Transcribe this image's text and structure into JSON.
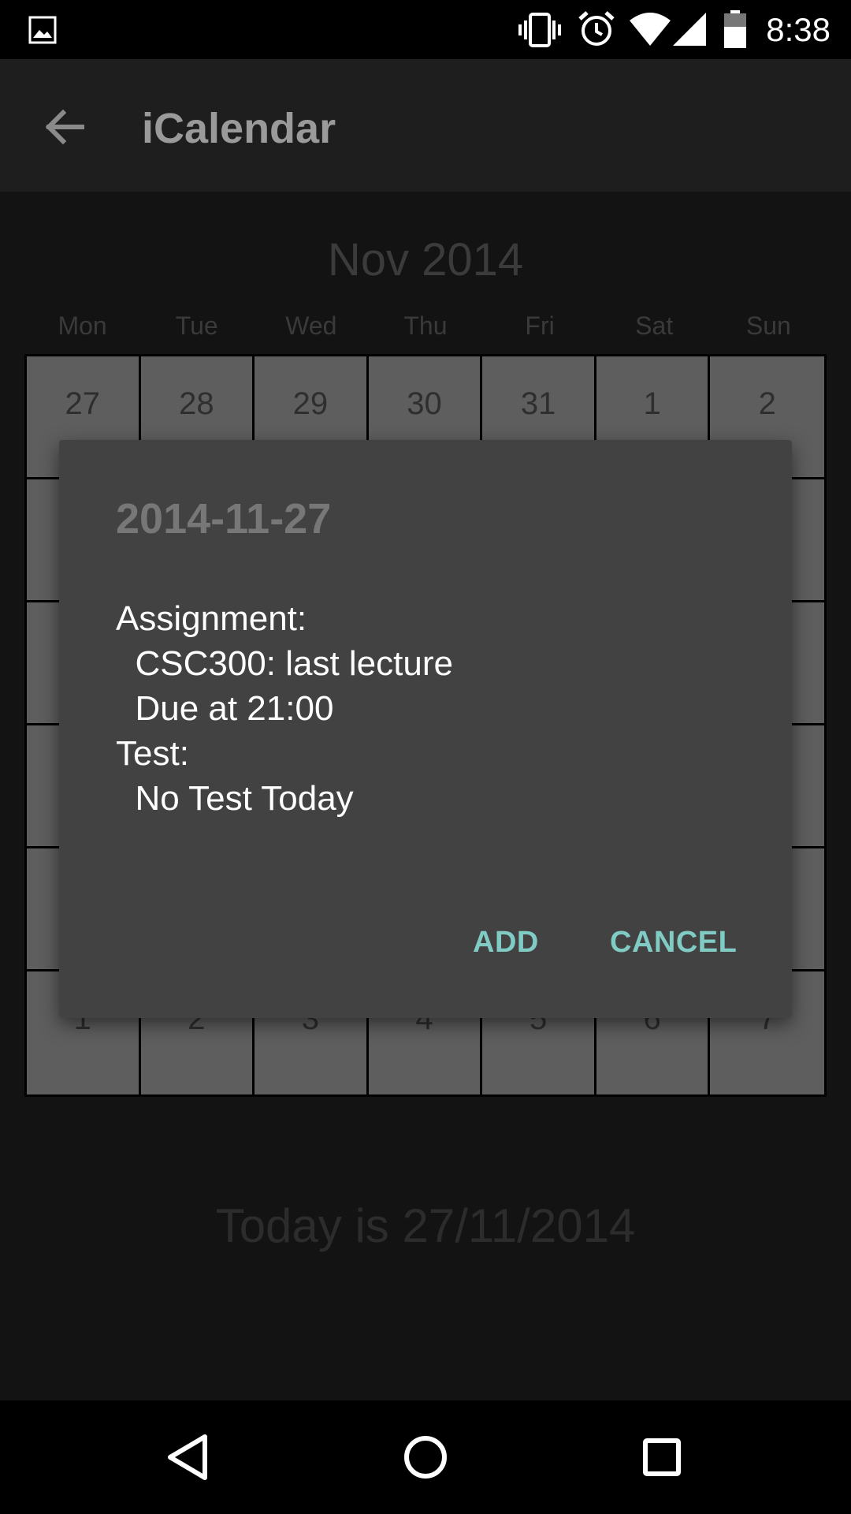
{
  "status_bar": {
    "time": "8:38",
    "icons": [
      "image-icon",
      "vibrate-icon",
      "alarm-icon",
      "wifi-icon",
      "signal-icon",
      "battery-icon"
    ]
  },
  "app_bar": {
    "back_icon": "arrow-left-icon",
    "title": "iCalendar"
  },
  "calendar": {
    "month": "Nov 2014",
    "weekdays": [
      "Mon",
      "Tue",
      "Wed",
      "Thu",
      "Fri",
      "Sat",
      "Sun"
    ],
    "weeks": [
      [
        "27",
        "28",
        "29",
        "30",
        "31",
        "1",
        "2"
      ],
      [
        "",
        "",
        "",
        "",
        "",
        "",
        ""
      ],
      [
        "",
        "",
        "",
        "",
        "",
        "",
        ""
      ],
      [
        "",
        "",
        "",
        "",
        "",
        "",
        ""
      ],
      [
        "",
        "",
        "",
        "",
        "",
        "",
        ""
      ],
      [
        "1",
        "2",
        "3",
        "4",
        "5",
        "6",
        "7"
      ]
    ],
    "today_text": "Today is 27/11/2014"
  },
  "dialog": {
    "title": "2014-11-27",
    "body": "Assignment:\n  CSC300: last lecture\n  Due at 21:00\nTest:\n  No Test Today",
    "add_label": "ADD",
    "cancel_label": "CANCEL",
    "accent_color": "#80cbc4"
  },
  "nav_bar": {
    "icons": [
      "back-triangle-icon",
      "home-circle-icon",
      "recents-square-icon"
    ]
  }
}
